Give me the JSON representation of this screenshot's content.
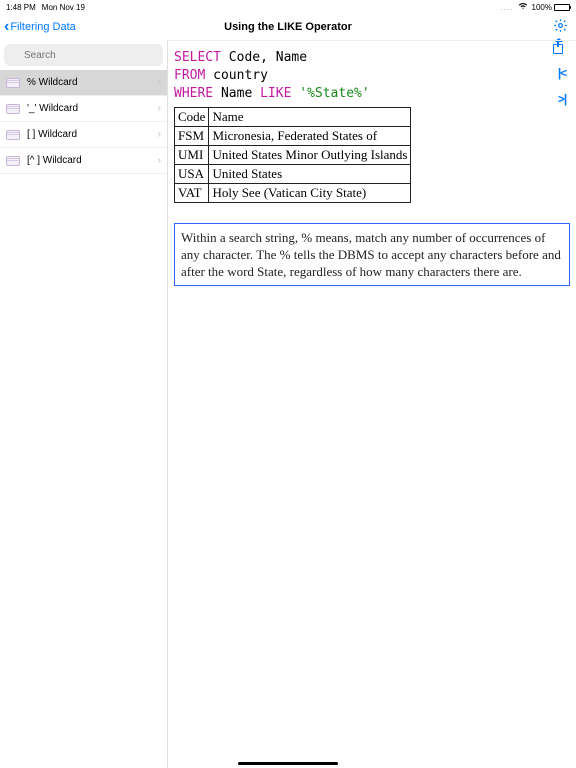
{
  "status": {
    "time": "1:48 PM",
    "date": "Mon Nov 19",
    "battery_pct": "100%"
  },
  "nav": {
    "back_label": "Filtering Data",
    "title": "Using the LIKE Operator"
  },
  "search": {
    "placeholder": "Search"
  },
  "sidebar": {
    "items": [
      {
        "label": "% Wildcard"
      },
      {
        "label": "'_' Wildcard"
      },
      {
        "label": "[ ] Wildcard"
      },
      {
        "label": "[^ ] Wildcard"
      }
    ]
  },
  "sql": {
    "line1_kw": "SELECT",
    "line1_rest": " Code, Name",
    "line2_kw": "FROM",
    "line2_rest": " country",
    "line3_kw1": "WHERE",
    "line3_mid": " Name ",
    "line3_kw2": "LIKE",
    "line3_sp": " ",
    "line3_str": "'%State%'"
  },
  "table": {
    "rows": [
      {
        "c0": "Code",
        "c1": "Name"
      },
      {
        "c0": "FSM",
        "c1": "Micronesia, Federated States of"
      },
      {
        "c0": "UMI",
        "c1": "United States Minor Outlying Islands"
      },
      {
        "c0": "USA",
        "c1": "United States"
      },
      {
        "c0": "VAT",
        "c1": "Holy See (Vatican City State)"
      }
    ]
  },
  "explanation": "Within a search string, % means, match any number of occurrences of any character. The % tells the DBMS to accept any characters before and after the word State, regardless of how many characters there are."
}
